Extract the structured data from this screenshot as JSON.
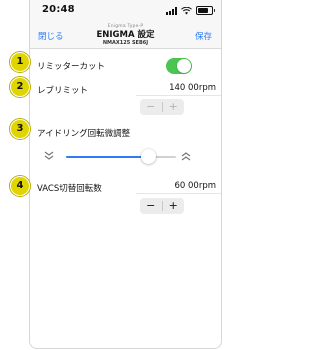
{
  "status_bar": {
    "time": "20:48",
    "battery_level": 0.8
  },
  "nav": {
    "back_label": "閉じる",
    "save_label": "保存",
    "super_title": "Enigma Type-P",
    "title": "ENIGMA 設定",
    "subtitle": "NMAX125 SEB6J"
  },
  "badges": [
    "1",
    "2",
    "3",
    "4"
  ],
  "limiter_cut": {
    "label": "リミッターカット",
    "enabled": true
  },
  "rev_limit": {
    "label": "レブリミット",
    "value": "140 00rpm",
    "minus": "−",
    "plus": "+"
  },
  "idle_adjust": {
    "label": "アイドリング回転微調整",
    "slider_value": 0.75
  },
  "vacs_switch": {
    "label": "VACS切替回転数",
    "value": "60 00rpm",
    "minus": "−",
    "plus": "+"
  },
  "colors": {
    "accent": "#2f7cf6",
    "toggle_on": "#4bc552",
    "badge": "#e1d500"
  },
  "icons": {
    "slider_min": "chevrons-down-icon",
    "slider_max": "chevrons-up-icon"
  }
}
